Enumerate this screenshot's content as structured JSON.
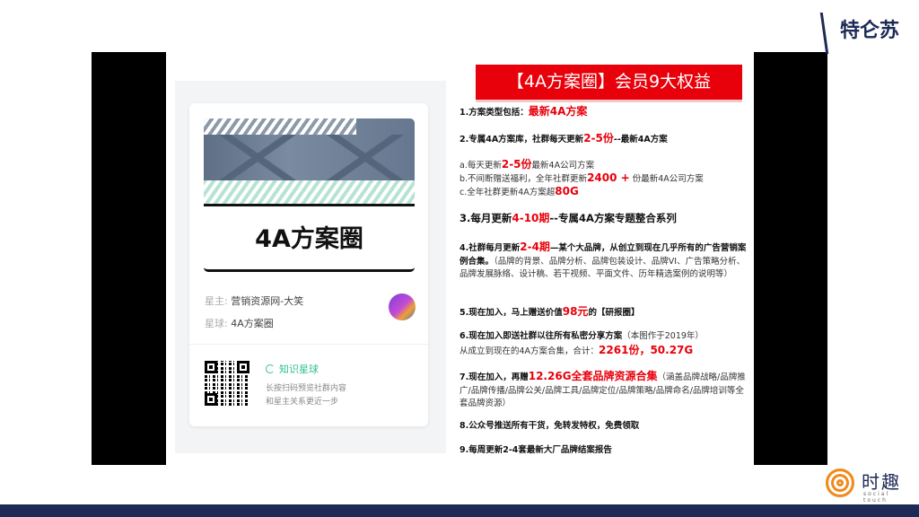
{
  "logos": {
    "top": "特仑苏",
    "bottom_name": "时趣",
    "bottom_sub": "social touch"
  },
  "card": {
    "cover_title": "4A方案圈",
    "owner_label": "星主:",
    "owner_value": "营销资源网-大笑",
    "planet_label": "星球:",
    "planet_value": "4A方案圈",
    "brand": "知识星球",
    "hint_line1": "长按扫码预览社群内容",
    "hint_line2": "和星主关系更近一步"
  },
  "banner": "【4A方案圈】会员9大权益",
  "paragraphs": [
    [
      {
        "t": "1.方案类型包括：",
        "s": "b"
      },
      {
        "t": "最新4A方案",
        "s": "r"
      }
    ],
    [
      {
        "t": "2.专属4A方案库，社群每天更新",
        "s": "b"
      },
      {
        "t": "2-5份",
        "s": "r"
      },
      {
        "t": "--最新4A方案",
        "s": "b"
      }
    ],
    [
      {
        "t": "a.每天更新",
        "s": "n"
      },
      {
        "t": "2-5份",
        "s": "r"
      },
      {
        "t": "最新4A公司方案",
        "s": "n"
      }
    ],
    [
      {
        "t": "b.不间断赠送福利，全年社群更新",
        "s": "n"
      },
      {
        "t": "2400 +",
        "s": "r"
      },
      {
        "t": " 份最新4A公司方案",
        "s": "n"
      }
    ],
    [
      {
        "t": "c.全年社群更新4A方案超",
        "s": "n"
      },
      {
        "t": "80G",
        "s": "r"
      }
    ],
    [
      {
        "t": "3.每月更新",
        "s": "b"
      },
      {
        "t": "4-10期",
        "s": "r"
      },
      {
        "t": "--专属4A方案专题整合系列",
        "s": "b"
      }
    ],
    [
      {
        "t": "4.社群每月更新",
        "s": "b"
      },
      {
        "t": "2-4期",
        "s": "r"
      },
      {
        "t": "—某个大品牌，从创立到现在几乎所有的广告营销案例合集。",
        "s": "b"
      },
      {
        "t": "（品牌的背景、品牌分析、品牌包装设计、品牌VI、广告策略分析、品牌发展脉络、设计稿、若干视频、平面文件、历年精选案例的说明等）",
        "s": "n"
      }
    ],
    [
      {
        "t": "5.现在加入，马上赠送价值",
        "s": "b"
      },
      {
        "t": "98元",
        "s": "r"
      },
      {
        "t": "的【研报圈】",
        "s": "b"
      }
    ],
    [
      {
        "t": "6.现在加入即送社群以往所有私密分享方案",
        "s": "b"
      },
      {
        "t": "（本图作于2019年）",
        "s": "n"
      },
      {
        "t": "从成立到现在的4A方案合集，合计：",
        "s": "n"
      },
      {
        "t": "2261份，50.27G",
        "s": "r"
      }
    ],
    [
      {
        "t": "7.现在加入，再赠",
        "s": "b"
      },
      {
        "t": "12.26G全套品牌资源合集",
        "s": "r"
      },
      {
        "t": "（涵盖品牌战略/品牌推广/品牌传播/品牌公关/品牌工具/品牌定位/品牌策略/品牌命名/品牌培训等全套品牌资源）",
        "s": "n"
      }
    ],
    [
      {
        "t": "8.公众号推送所有干货，免转发特权，免费领取",
        "s": "b"
      }
    ],
    [
      {
        "t": "9.每周更新2-4套最新大厂品牌结案报告",
        "s": "b"
      }
    ]
  ]
}
